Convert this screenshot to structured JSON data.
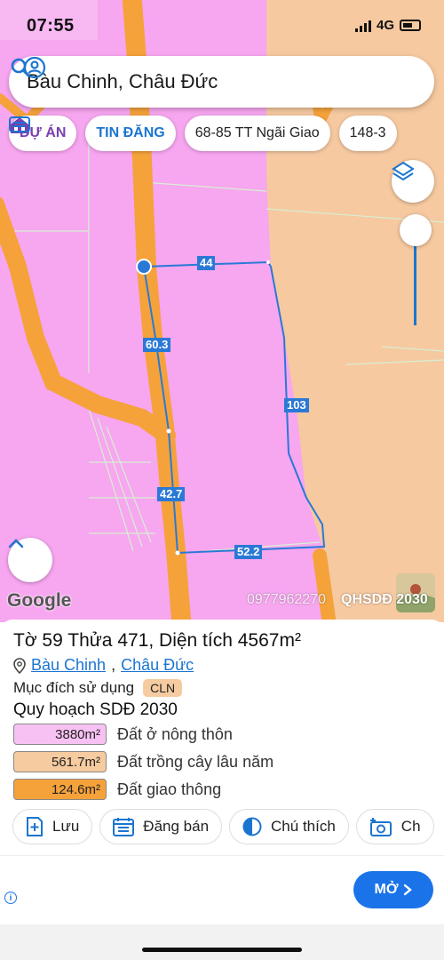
{
  "status_bar": {
    "time": "07:55",
    "network": "4G"
  },
  "search": {
    "query": "Bàu Chinh, Châu Đức"
  },
  "chips": [
    {
      "label": "DỰ ÁN",
      "icon": "house-icon"
    },
    {
      "label": "TIN ĐĂNG",
      "icon": "listing-icon"
    },
    {
      "label": "68-85 TT Ngãi Giao"
    },
    {
      "label": "148-3"
    }
  ],
  "map": {
    "edge_labels": {
      "top": "44",
      "left_upper": "60.3",
      "right": "103",
      "left_lower": "42.7",
      "bottom": "52.2"
    },
    "attribution": "Google",
    "watermark": "0977962270",
    "layer_name": "QHSDĐ 2030",
    "colors": {
      "residential": "#f7a6f0",
      "perennial": "#f6c9a0",
      "transport": "#f5a23a",
      "boundary": "#2a79d6"
    }
  },
  "parcel": {
    "title": "Tờ 59 Thửa 471, Diện tích 4567m²",
    "address_parts": [
      "Bàu Chinh",
      "Châu Đức"
    ],
    "address_sep": ",",
    "purpose_label": "Mục đích sử dụng",
    "purpose_code": "CLN",
    "plan_title": "Quy hoạch SDĐ 2030",
    "legend": [
      {
        "area": "3880m²",
        "label": "Đất ở nông thôn",
        "color": "#f7c2f3"
      },
      {
        "area": "561.7m²",
        "label": "Đất trồng cây lâu năm",
        "color": "#f6cba0"
      },
      {
        "area": "124.6m²",
        "label": "Đất giao thông",
        "color": "#f5a23a"
      }
    ]
  },
  "actions": [
    {
      "label": "Lưu",
      "icon": "save-plus-icon"
    },
    {
      "label": "Đăng bán",
      "icon": "calendar-list-icon"
    },
    {
      "label": "Chú thích",
      "icon": "legend-half-circle-icon"
    },
    {
      "label": "Ch",
      "icon": "add-photo-icon"
    }
  ],
  "ad": {
    "button_label": "MỞ"
  }
}
